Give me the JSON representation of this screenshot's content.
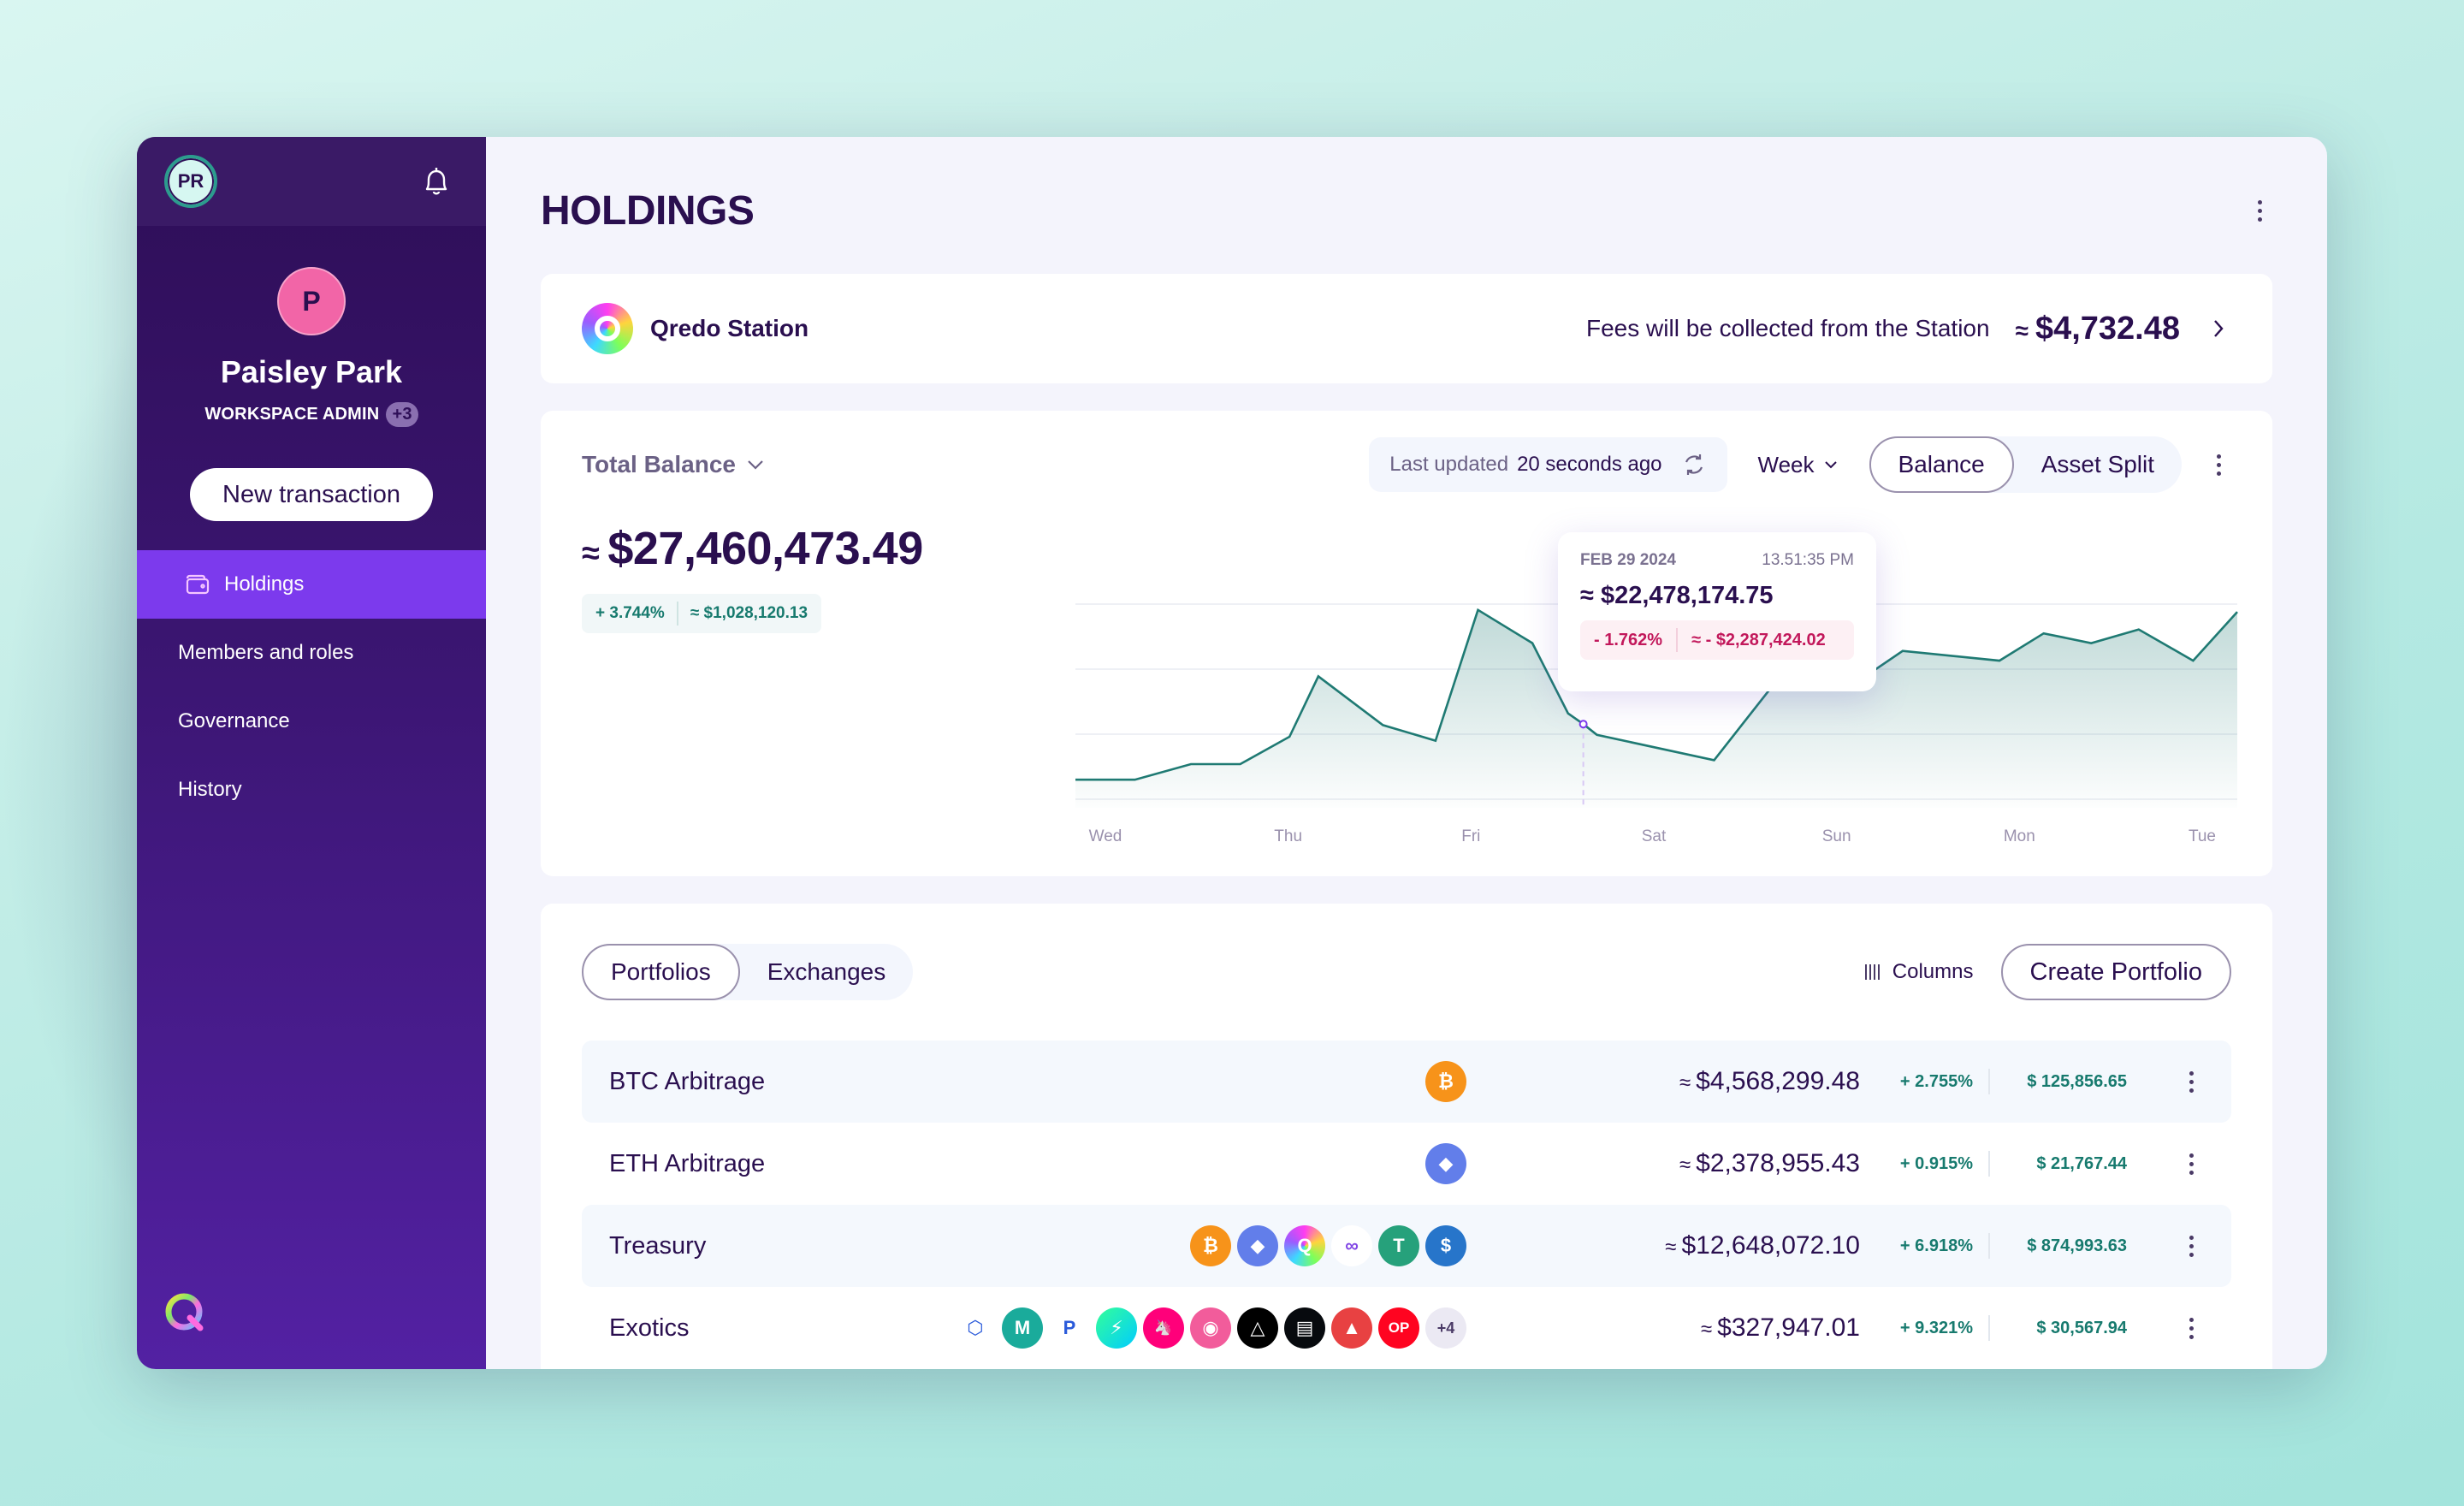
{
  "sidebar": {
    "workspace_initials": "PR",
    "user_initial": "P",
    "user_name": "Paisley Park",
    "user_role": "WORKSPACE ADMIN",
    "role_extra_badge": "+3",
    "new_transaction_label": "New transaction",
    "nav": [
      {
        "label": "Holdings",
        "icon": "wallet-icon",
        "active": true
      },
      {
        "label": "Members and roles",
        "active": false
      },
      {
        "label": "Governance",
        "active": false
      },
      {
        "label": "History",
        "active": false
      }
    ],
    "brand_colors": {
      "active_nav": "#7c3aed",
      "user_avatar": "#f265a7"
    }
  },
  "header": {
    "title": "HOLDINGS"
  },
  "station": {
    "name": "Qredo Station",
    "fees_label": "Fees will be collected from the Station",
    "approx_symbol": "≈",
    "fees_value": "$4,732.48"
  },
  "balance": {
    "selector_label": "Total Balance",
    "approx_symbol": "≈",
    "value": "$27,460,473.49",
    "change_pct": "+ 3.744%",
    "change_abs": "≈ $1,028,120.13",
    "last_updated_label": "Last updated",
    "last_updated_value": "20 seconds ago",
    "period": "Week",
    "view_tabs": [
      {
        "label": "Balance",
        "active": true
      },
      {
        "label": "Asset Split",
        "active": false
      }
    ],
    "tooltip": {
      "date": "FEB 29 2024",
      "time": "13.51:35 PM",
      "value": "≈ $22,478,174.75",
      "change_pct": "- 1.762%",
      "change_abs": "≈ - $2,287,424.02"
    }
  },
  "chart_data": {
    "type": "area",
    "title": "",
    "xlabel": "",
    "ylabel": "",
    "x_tick_labels": [
      "Wed",
      "Thu",
      "Fri",
      "Sat",
      "Sun",
      "Mon",
      "Tue"
    ],
    "grid": true,
    "y_axis_labels_shown": false,
    "value_scale": "relative index (0 = bottom gridline, 100 = top gridline)",
    "ylim": [
      0,
      100
    ],
    "x_range_days": [
      0,
      6.2
    ],
    "series": [
      {
        "name": "Total Balance",
        "color": "#1f7a73",
        "points": [
          {
            "x": 0.0,
            "y": 10
          },
          {
            "x": 0.35,
            "y": 10
          },
          {
            "x": 0.68,
            "y": 18
          },
          {
            "x": 0.97,
            "y": 18
          },
          {
            "x": 1.26,
            "y": 32
          },
          {
            "x": 1.43,
            "y": 63
          },
          {
            "x": 1.81,
            "y": 38
          },
          {
            "x": 2.12,
            "y": 30
          },
          {
            "x": 2.37,
            "y": 97
          },
          {
            "x": 2.69,
            "y": 80
          },
          {
            "x": 2.9,
            "y": 44
          },
          {
            "x": 2.99,
            "y": 38.5
          },
          {
            "x": 3.07,
            "y": 33
          },
          {
            "x": 3.76,
            "y": 20
          },
          {
            "x": 4.13,
            "y": 61
          },
          {
            "x": 4.55,
            "y": 57
          },
          {
            "x": 4.87,
            "y": 76
          },
          {
            "x": 5.44,
            "y": 71
          },
          {
            "x": 5.7,
            "y": 85
          },
          {
            "x": 5.98,
            "y": 80
          },
          {
            "x": 6.26,
            "y": 87
          },
          {
            "x": 6.58,
            "y": 71
          },
          {
            "x": 6.84,
            "y": 96
          }
        ],
        "hover_index": 11
      }
    ]
  },
  "portfolios": {
    "tabs": [
      {
        "label": "Portfolios",
        "active": true
      },
      {
        "label": "Exchanges",
        "active": false
      }
    ],
    "columns_label": "Columns",
    "create_label": "Create Portfolio",
    "rows": [
      {
        "name": "BTC Arbitrage",
        "assets": [
          {
            "icon": "bitcoin-icon",
            "glyph": "₿",
            "color": "#f7931a"
          }
        ],
        "total": "$4,568,299.48",
        "change_pct": "+ 2.755%",
        "gain": "$ 125,856.65"
      },
      {
        "name": "ETH Arbitrage",
        "assets": [
          {
            "icon": "ethereum-icon",
            "glyph": "◆",
            "color": "#627eea"
          }
        ],
        "total": "$2,378,955.43",
        "change_pct": "+ 0.915%",
        "gain": "$ 21,767.44"
      },
      {
        "name": "Treasury",
        "assets": [
          {
            "icon": "bitcoin-icon",
            "glyph": "₿",
            "color": "#f7931a"
          },
          {
            "icon": "ethereum-icon",
            "glyph": "◆",
            "color": "#627eea"
          },
          {
            "icon": "qredo-icon",
            "glyph": "Q",
            "color": "#c44dff"
          },
          {
            "icon": "polygon-icon",
            "glyph": "∞",
            "color": "#ffffff"
          },
          {
            "icon": "tether-icon",
            "glyph": "T",
            "color": "#26a17b"
          },
          {
            "icon": "usdc-icon",
            "glyph": "$",
            "color": "#2775ca"
          }
        ],
        "total": "$12,648,072.10",
        "change_pct": "+ 6.918%",
        "gain": "$ 874,993.63"
      },
      {
        "name": "Exotics",
        "assets": [
          {
            "icon": "chainlink-icon",
            "glyph": "⬡",
            "color": "#ffffff"
          },
          {
            "icon": "maker-icon",
            "glyph": "M",
            "color": "#1aab9b"
          },
          {
            "icon": "pooltogether-icon",
            "glyph": "P",
            "color": "#ffffff"
          },
          {
            "icon": "thorchain-icon",
            "glyph": "⚡",
            "color": "#23dcc8"
          },
          {
            "icon": "uniswap-icon",
            "glyph": "🦄",
            "color": "#ff007a"
          },
          {
            "icon": "sushi-icon",
            "glyph": "◉",
            "color": "#f25c9b"
          },
          {
            "icon": "eos-icon",
            "glyph": "△",
            "color": "#000000"
          },
          {
            "icon": "compound-icon",
            "glyph": "▤",
            "color": "#070a0e"
          },
          {
            "icon": "avalanche-icon",
            "glyph": "▲",
            "color": "#e84142"
          },
          {
            "icon": "optimism-icon",
            "glyph": "OP",
            "color": "#ff0420"
          }
        ],
        "more_count": "+4",
        "total": "$327,947.01",
        "change_pct": "+ 9.321%",
        "gain": "$ 30,567.94"
      }
    ]
  }
}
